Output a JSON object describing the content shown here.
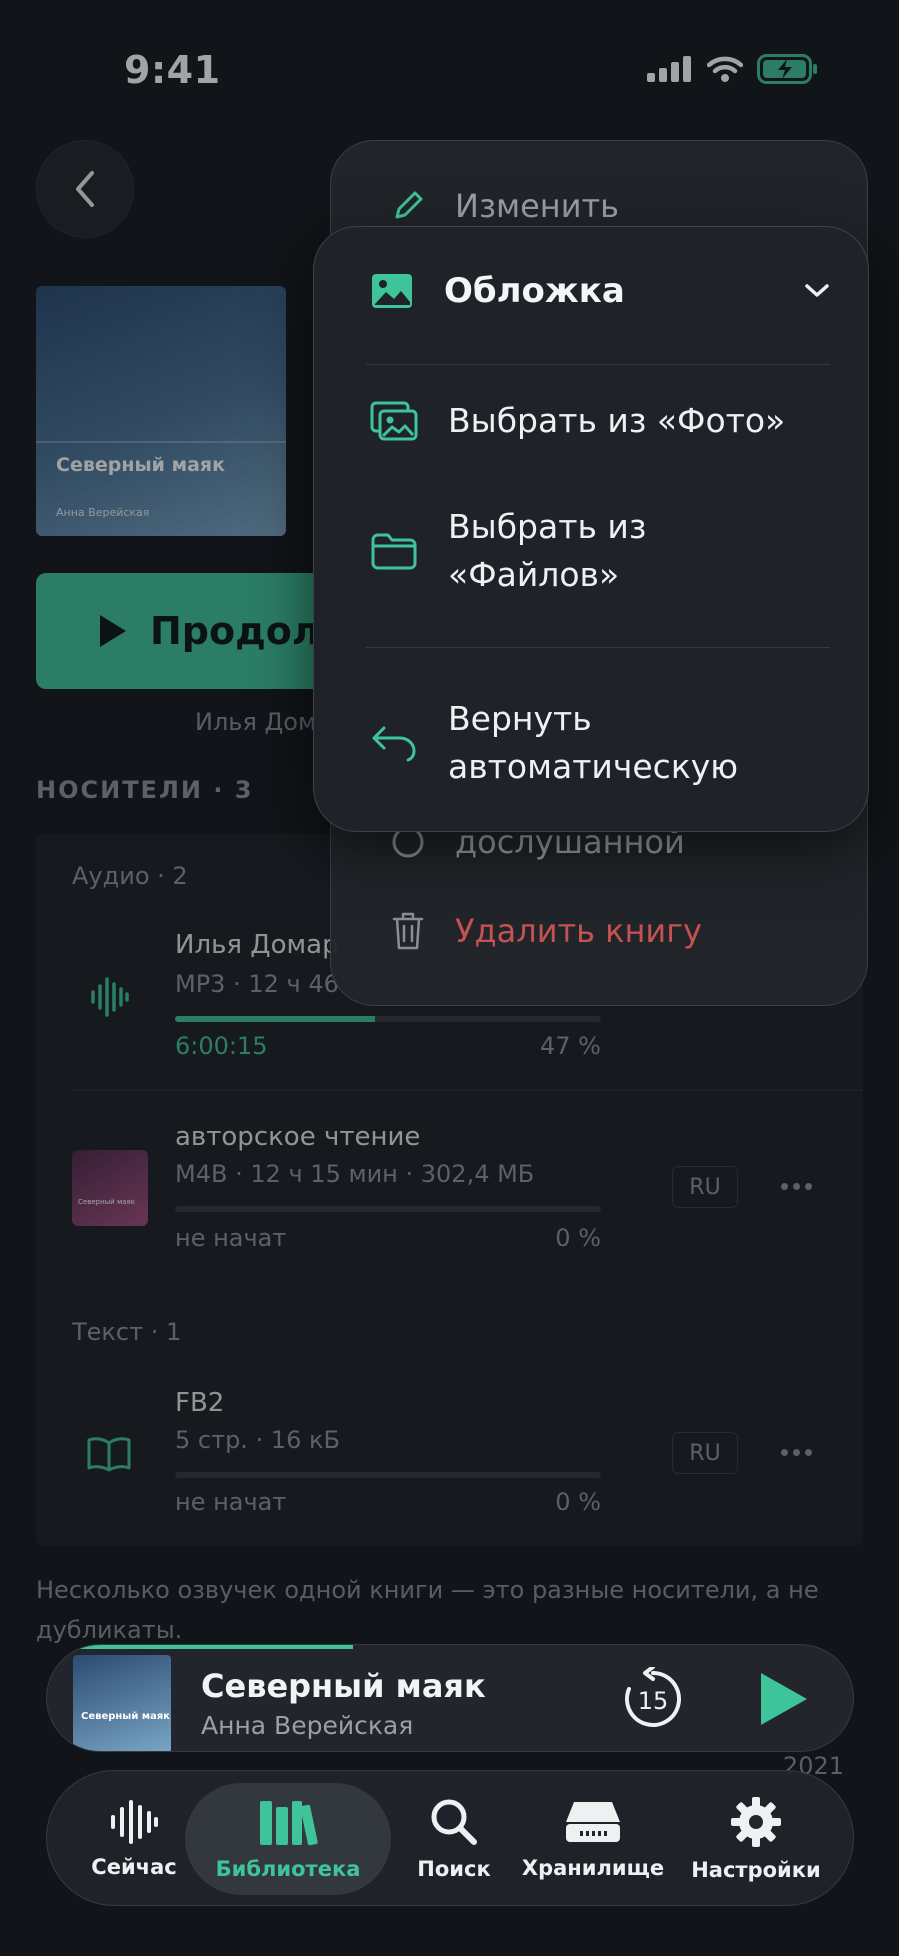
{
  "status_bar": {
    "time": "9:41"
  },
  "book": {
    "cover_title": "Северный маяк",
    "cover_author": "Анна Верейская",
    "continue_label": "Продолж",
    "narrator_line": "Илья Дом"
  },
  "media": {
    "section_title": "НОСИТЕЛИ · 3",
    "audio_group": "Аудио · 2",
    "text_group": "Текст · 1",
    "items": [
      {
        "title": "Илья Домар",
        "meta": "MP3 · 12 ч 46",
        "status": "6:00:15",
        "percent": "47 %",
        "progress": 0.47,
        "lang": ""
      },
      {
        "title": "авторское чтение",
        "meta": "M4B · 12 ч 15 мин · 302,4 МБ",
        "status": "не начат",
        "percent": "0 %",
        "progress": 0,
        "lang": "RU",
        "cover_text": "Северный маяк"
      },
      {
        "title": "FB2",
        "meta": "5 стр. · 16 кБ",
        "status": "не начат",
        "percent": "0 %",
        "progress": 0,
        "lang": "RU"
      }
    ],
    "footnote": "Несколько озвучек одной книги — это разные носители, а не дубликаты."
  },
  "menu_back": {
    "edit": "Изменить",
    "mark_finished": "дослушанной",
    "delete": "Удалить книгу"
  },
  "menu_front": {
    "header": "Обложка",
    "pick_photos": "Выбрать из «Фото»",
    "pick_files_1": "Выбрать из",
    "pick_files_2": "«Файлов»",
    "restore_1": "Вернуть",
    "restore_2": "автоматическую"
  },
  "mini_player": {
    "title": "Северный маяк",
    "author": "Анна Верейская",
    "cover_text": "Северный маяк",
    "skip_seconds": "15",
    "progress": 0.38
  },
  "background_row": {
    "year": "2021"
  },
  "tabs": [
    {
      "label": "Сейчас",
      "icon": "waveform-icon"
    },
    {
      "label": "Библиотека",
      "icon": "library-icon",
      "active": true
    },
    {
      "label": "Поиск",
      "icon": "search-icon"
    },
    {
      "label": "Хранилище",
      "icon": "storage-icon"
    },
    {
      "label": "Настройки",
      "icon": "gear-icon"
    }
  ],
  "colors": {
    "accent": "#3fc49a",
    "danger": "#c45252",
    "background": "#16191e"
  }
}
